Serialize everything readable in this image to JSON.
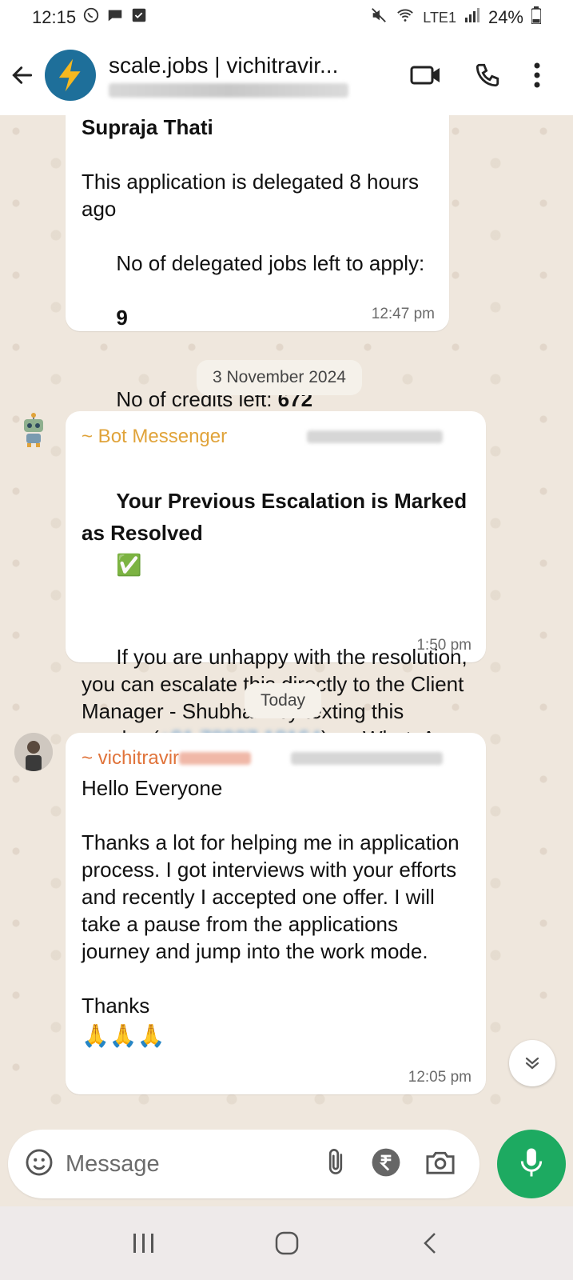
{
  "status_bar": {
    "time": "12:15",
    "battery": "24%",
    "network_label": "LTE1",
    "icons": [
      "whatsapp-icon",
      "chat-bubble-icon",
      "checkbox-icon",
      "mute-icon",
      "wifi-icon",
      "signal-icon",
      "battery-icon"
    ]
  },
  "header": {
    "title": "scale.jobs | vichitravir...",
    "icons": [
      "back-arrow-icon",
      "group-avatar",
      "video-call-icon",
      "voice-call-icon",
      "more-vert-icon"
    ]
  },
  "messages": [
    {
      "name_line": "Supraja Thati",
      "line1": "This application is delegated 8 hours ago",
      "line2": "No of delegated jobs left to apply:",
      "line2_value": "9",
      "line3": "No of credits left: ",
      "line3_value": "672",
      "time": "12:47 pm"
    },
    {
      "date_chip": "3 November 2024",
      "sender": "~ Bot Messenger",
      "sender_color": "#e0a33a",
      "title": "Your Previous Escalation is Marked as Resolved",
      "title_emoji": "✅",
      "body": "If you are unhappy with the resolution, you can escalate this directly to the Client Manager - Shubham by texting this number(",
      "body_link": "+91 78927 18164",
      "body_end": ") on WhatsApp.",
      "time": "1:50 pm"
    },
    {
      "date_chip": "Today",
      "sender": "~ vichitravir",
      "sender_color": "#e0733a",
      "body": "Hello Everyone\n\nThanks a lot for helping me in application process. I got interviews with your efforts and recently I accepted one offer. I will take a pause from the applications journey and jump into the work mode.\n\nThanks",
      "emoji": "🙏🙏🙏",
      "time": "12:05 pm"
    }
  ],
  "input": {
    "placeholder": "Message",
    "icons": [
      "emoji-icon",
      "attach-icon",
      "rupee-payment-icon",
      "camera-icon",
      "mic-icon"
    ]
  },
  "nav": {
    "icons": [
      "recent-apps-icon",
      "home-icon",
      "back-icon"
    ]
  },
  "colors": {
    "accent": "#1daa61",
    "chat_bg": "#efe7dd",
    "link": "#4a8fcf"
  }
}
